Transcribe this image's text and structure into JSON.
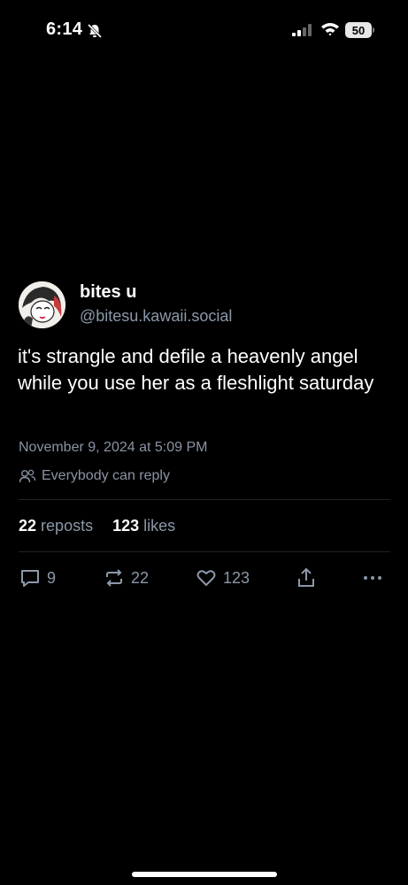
{
  "status_bar": {
    "time": "6:14",
    "battery": "50",
    "icons": [
      "bell-slash-icon",
      "signal-icon",
      "wifi-icon",
      "battery-icon"
    ]
  },
  "post": {
    "display_name": "bites u",
    "handle": "@bitesu.kawaii.social",
    "text": "it's strangle and defile a heavenly angel while you use her as a fleshlight saturday",
    "timestamp": "November 9, 2024 at 5:09 PM",
    "reply_setting": "Everybody can reply",
    "stats": {
      "reposts_count": "22",
      "reposts_label": "reposts",
      "likes_count": "123",
      "likes_label": "likes"
    },
    "actions": {
      "replies": "9",
      "reposts": "22",
      "likes": "123"
    }
  },
  "colors": {
    "background": "#000000",
    "text_primary": "#ffffff",
    "text_secondary": "#8c98a8",
    "divider": "#1e2329"
  }
}
